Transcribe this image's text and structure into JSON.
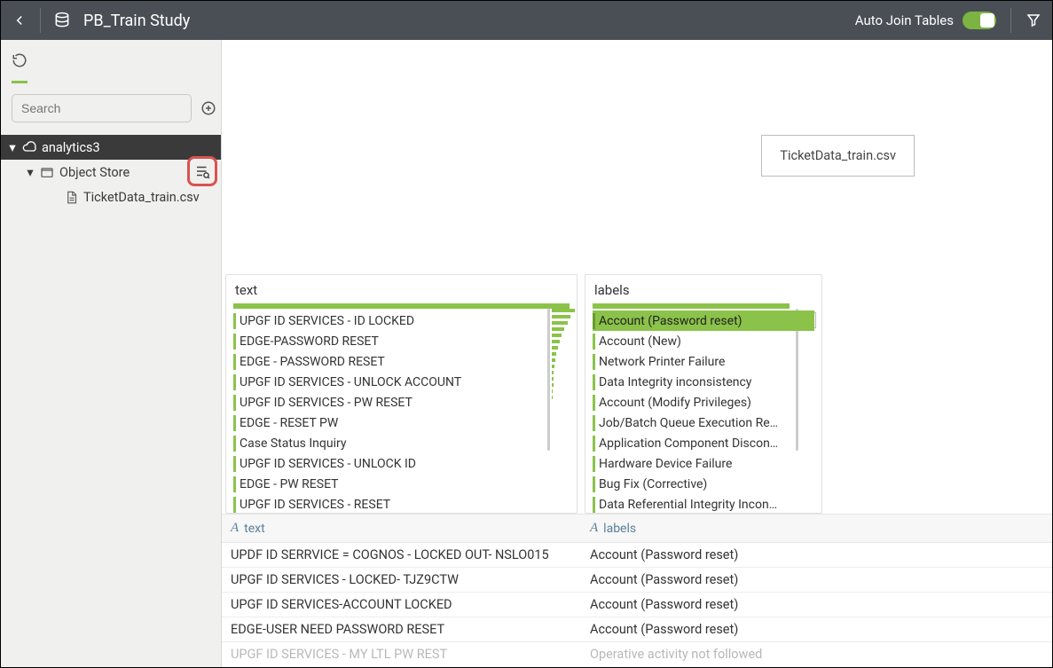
{
  "header": {
    "title": "PB_Train Study",
    "auto_join_label": "Auto Join Tables",
    "auto_join_on": true
  },
  "sidebar": {
    "search_placeholder": "Search",
    "tree": {
      "root": "analytics3",
      "child": "Object Store",
      "leaf": "TicketData_train.csv"
    }
  },
  "canvas": {
    "card_label": "TicketData_train.csv"
  },
  "panels": {
    "text": {
      "header": "text",
      "items": [
        "UPGF ID SERVICES - ID LOCKED",
        "EDGE-PASSWORD RESET",
        "EDGE - PASSWORD RESET",
        "UPGF ID SERVICES - UNLOCK ACCOUNT",
        "UPGF ID SERVICES - PW RESET",
        "EDGE - RESET PW",
        "Case Status Inquiry",
        "UPGF ID SERVICES - UNLOCK ID",
        "EDGE - PW RESET",
        "UPGF ID SERVICES - RESET"
      ]
    },
    "labels": {
      "header": "labels",
      "items": [
        "Account (Password reset)",
        "Account (New)",
        "Network Printer Failure",
        "Data Integrity inconsistency",
        "Account (Modify Privileges)",
        "Job/Batch Queue Execution Re…",
        "Application Component Discon…",
        "Hardware Device Failure",
        "Bug Fix (Corrective)",
        "Data Referential Integrity Incon…"
      ],
      "selected_index": 0
    }
  },
  "table": {
    "columns": {
      "c1": "text",
      "c2": "labels",
      "type_prefix": "A"
    },
    "rows": [
      {
        "text": "UPDF ID SERRVICE = COGNOS - LOCKED OUT-  NSLO015",
        "label": "Account (Password reset)"
      },
      {
        "text": "UPGF ID SERVICES - LOCKED- TJZ9CTW",
        "label": "Account (Password reset)"
      },
      {
        "text": "UPGF ID SERVICES-ACCOUNT LOCKED",
        "label": "Account (Password reset)"
      },
      {
        "text": "EDGE-USER NEED PASSWORD RESET",
        "label": "Account (Password reset)"
      },
      {
        "text": "UPGF ID SERVICES - MY LTL PW REST",
        "label": "Operative activity not followed"
      }
    ]
  }
}
